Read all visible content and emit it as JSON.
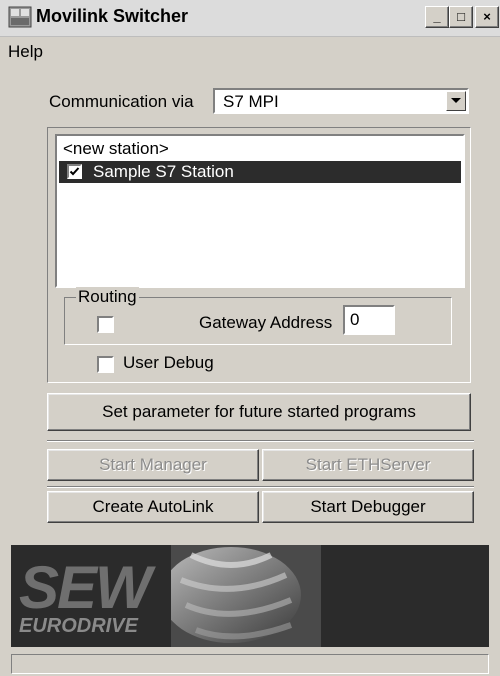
{
  "window": {
    "title": "Movilink Switcher",
    "min_glyph": "_",
    "max_glyph": "□",
    "close_glyph": "×"
  },
  "menu": {
    "help": "Help"
  },
  "communication": {
    "label": "Communication via",
    "value": "S7 MPI"
  },
  "stations": [
    {
      "label": "<new station>",
      "checked": false,
      "selected": false
    },
    {
      "label": "Sample S7 Station",
      "checked": true,
      "selected": true
    }
  ],
  "routing": {
    "legend": "Routing",
    "checked": false,
    "gateway_label": "Gateway Address",
    "gateway_value": "0"
  },
  "user_debug": {
    "label": "User Debug",
    "checked": false
  },
  "buttons": {
    "set_parameter": "Set parameter for future started programs",
    "start_manager": "Start Manager",
    "start_ethserver": "Start ETHServer",
    "create_autolink": "Create AutoLink",
    "start_debugger": "Start Debugger"
  },
  "logo": {
    "brand": "SEW",
    "sub": "EURODRIVE"
  },
  "colors": {
    "face": "#d4d0c8",
    "selection": "#2c2c2c",
    "banner": "#2b2b2b"
  }
}
